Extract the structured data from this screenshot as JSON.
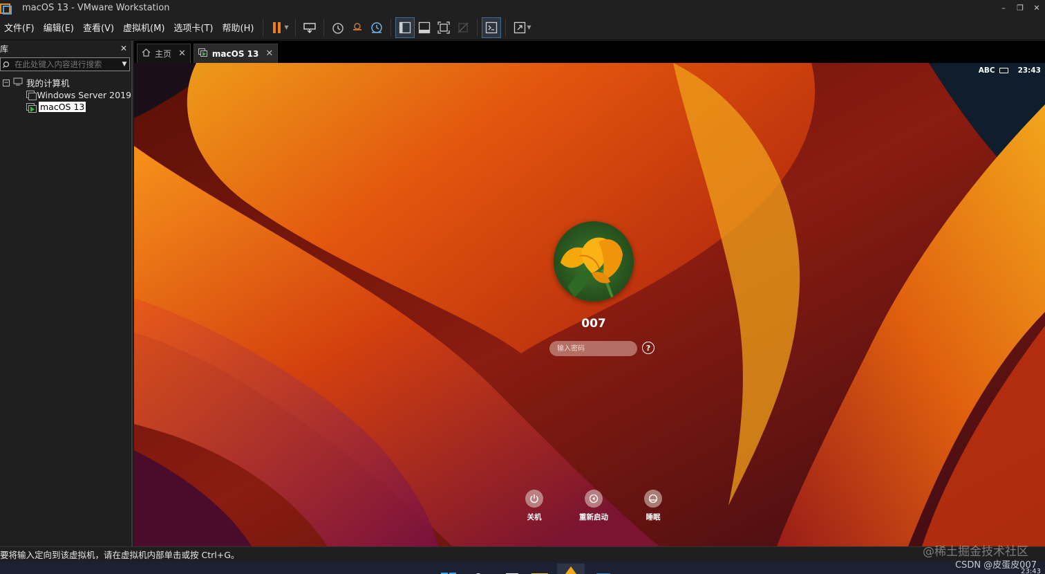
{
  "window": {
    "title": "macOS 13 - VMware Workstation",
    "controls": [
      "–",
      "❐",
      "✕"
    ]
  },
  "menu": {
    "items": [
      "文件(F)",
      "编辑(E)",
      "查看(V)",
      "虚拟机(M)",
      "选项卡(T)",
      "帮助(H)"
    ]
  },
  "toolbar": {
    "icons": [
      "pause-icon",
      "send-ctrl-alt-del-icon",
      "snapshot-icon",
      "revert-snapshot-icon",
      "snapshot-manager-icon",
      "show-library-icon",
      "thumbnail-bar-icon",
      "full-screen-icon",
      "unity-icon",
      "console-view-icon",
      "stretch-icon"
    ],
    "accent": "#f07c22"
  },
  "library": {
    "title": "库",
    "search_placeholder": "在此处键入内容进行搜索",
    "root": "我的计算机",
    "vms": [
      "Windows Server 2019",
      "macOS 13"
    ],
    "selected": "macOS 13"
  },
  "tabs": [
    {
      "label": "主页",
      "icon": "home-icon",
      "active": false
    },
    {
      "label": "macOS 13",
      "icon": "vm-running-icon",
      "active": true
    }
  ],
  "guest": {
    "menubar_input": "ABC",
    "clock": "23:43",
    "username": "007",
    "password_placeholder": "输入密码",
    "help_symbol": "?",
    "actions": [
      {
        "label": "关机",
        "icon": "power-icon"
      },
      {
        "label": "重新启动",
        "icon": "restart-icon"
      },
      {
        "label": "睡眠",
        "icon": "sleep-icon"
      }
    ]
  },
  "status": {
    "hint": "要将输入定向到该虚拟机，请在虚拟机内部单击或按 Ctrl+G。"
  },
  "watermarks": {
    "top": "@稀土掘金技术社区",
    "bottom": "CSDN @皮蛋皮007"
  },
  "taskbar": {
    "time": "23:43"
  }
}
